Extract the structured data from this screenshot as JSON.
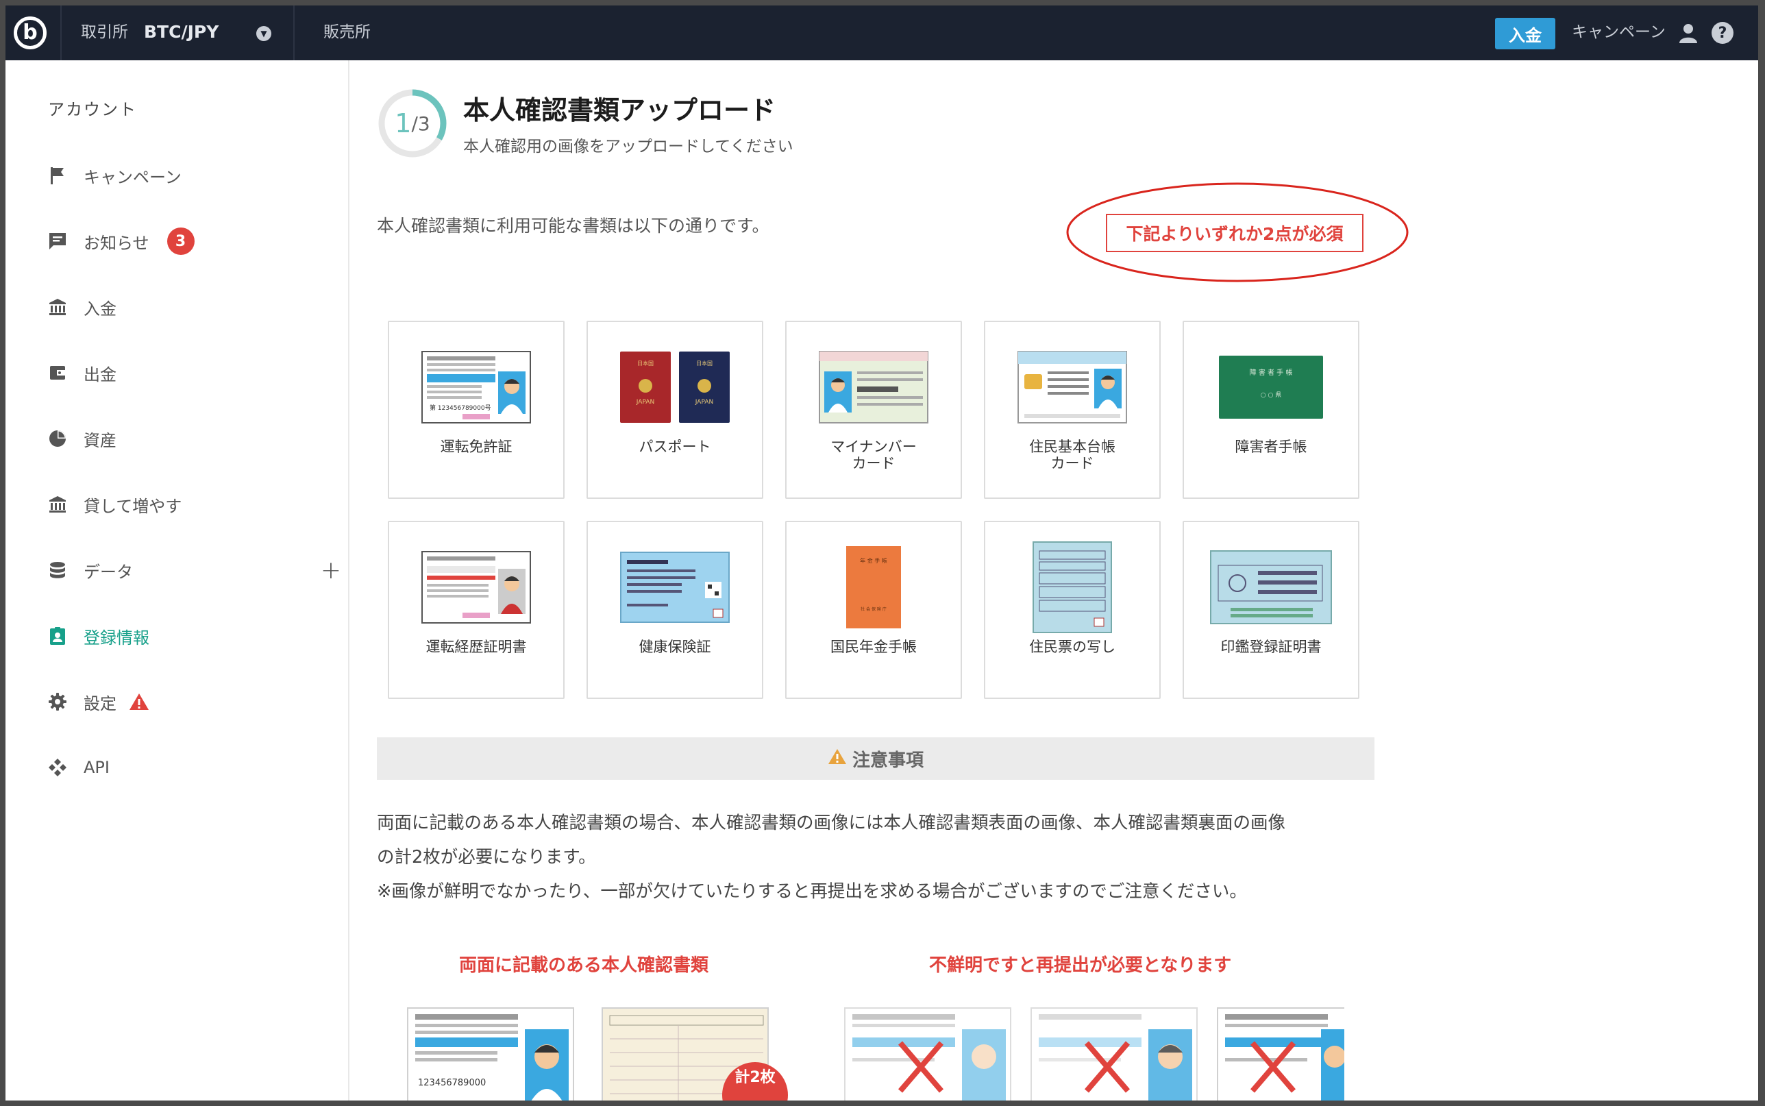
{
  "topbar": {
    "logo": "b",
    "exchange_label": "取引所",
    "pair": "BTC/JPY",
    "shop_label": "販売所",
    "deposit_button": "入金",
    "campaign_link": "キャンペーン"
  },
  "sidebar": {
    "heading": "アカウント",
    "items": [
      {
        "label": "キャンペーン",
        "icon": "flag-icon"
      },
      {
        "label": "お知らせ",
        "icon": "message-icon",
        "badge": "3"
      },
      {
        "label": "入金",
        "icon": "bank-icon"
      },
      {
        "label": "出金",
        "icon": "wallet-icon"
      },
      {
        "label": "資産",
        "icon": "pie-chart-icon"
      },
      {
        "label": "貸して増やす",
        "icon": "bank-icon"
      },
      {
        "label": "データ",
        "icon": "database-icon"
      },
      {
        "label": "登録情報",
        "icon": "badge-icon"
      },
      {
        "label": "設定",
        "icon": "gear-icon"
      },
      {
        "label": "API",
        "icon": "api-icon"
      }
    ]
  },
  "main": {
    "step_current": "1",
    "step_total": "/3",
    "step_progress": 0.333,
    "title": "本人確認書類アップロード",
    "subtitle": "本人確認用の画像をアップロードしてください",
    "intro": "本人確認書類に利用可能な書類は以下の通りです。",
    "requirement": "下記よりいずれか2点が必須",
    "documents": [
      {
        "label": "運転免許証"
      },
      {
        "label": "パスポート"
      },
      {
        "label": "マイナンバー\nカード"
      },
      {
        "label": "住民基本台帳\nカード"
      },
      {
        "label": "障害者手帳"
      },
      {
        "label": "運転経歴証明書"
      },
      {
        "label": "健康保険証"
      },
      {
        "label": "国民年金手帳"
      },
      {
        "label": "住民票の写し"
      },
      {
        "label": "印鑑登録証明書"
      }
    ],
    "notice_title": "注意事項",
    "notice_line1": "両面に記載のある本人確認書類の場合、本人確認書類の画像には本人確認書類表面の画像、本人確認書類裏面の画像",
    "notice_line2": "の計2枚が必要になります。",
    "notice_line3": "※画像が鮮明でなかったり、一部が欠けていたりすると再提出を求める場合がございますのでご注意ください。",
    "example_left_title": "両面に記載のある本人確認書類",
    "example_right_title": "不鮮明ですと再提出が必要となります",
    "calc_badge": "計2枚",
    "license_number": "123456789000"
  },
  "colors": {
    "accent": "#17a08a",
    "danger": "#e0433d",
    "topbar": "#1b2230",
    "deposit": "#2f9bd6"
  }
}
